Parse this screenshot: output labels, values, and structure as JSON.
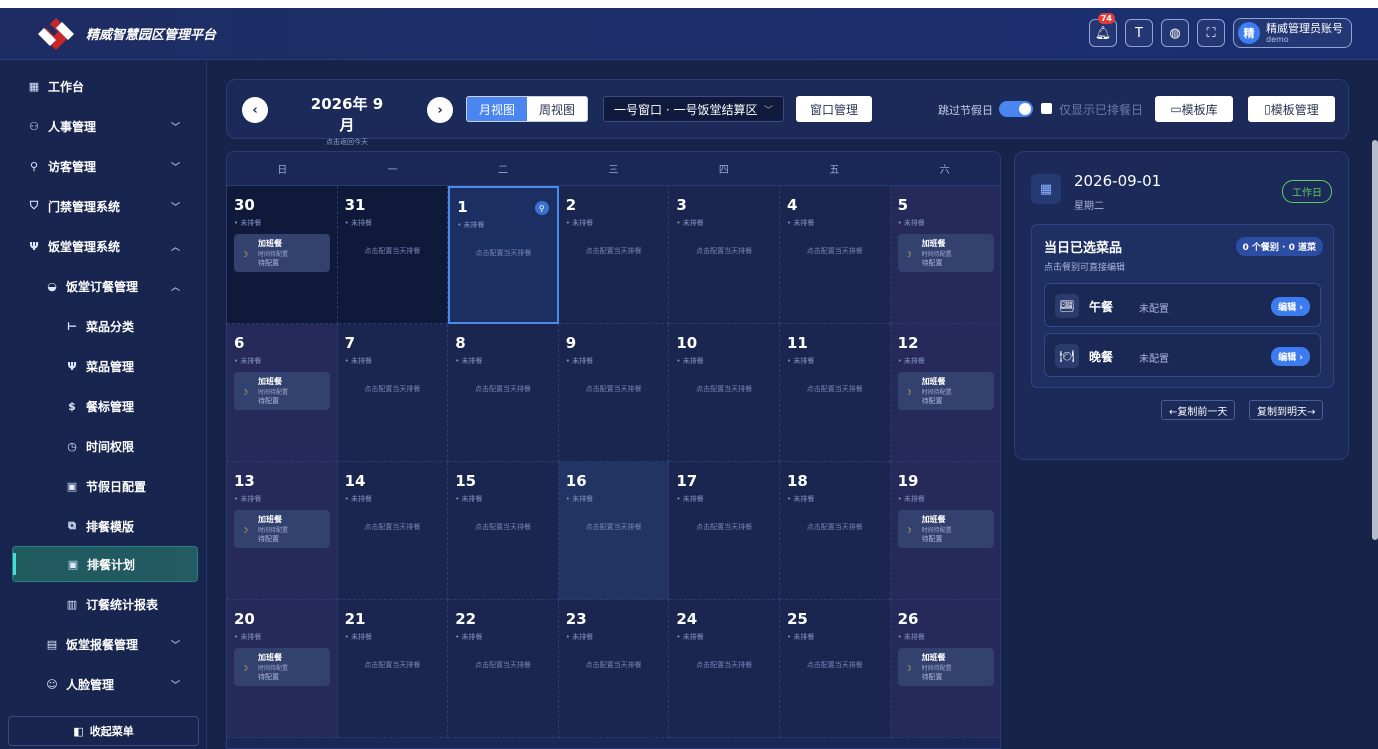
{
  "app": {
    "brand": "精威智慧园区管理平台"
  },
  "header": {
    "notification_count": "74",
    "font_label": "T",
    "user_avatar": "精",
    "user_name": "精威管理员账号",
    "user_role": "demo"
  },
  "sidebar": {
    "items": [
      {
        "label": "工作台",
        "icon": "grid-icon"
      },
      {
        "label": "人事管理",
        "icon": "users-icon"
      },
      {
        "label": "访客管理",
        "icon": "visitor-icon"
      },
      {
        "label": "门禁管理系统",
        "icon": "shield-icon"
      },
      {
        "label": "饭堂管理系统",
        "icon": "utensils-icon"
      },
      {
        "label": "饭堂订餐管理",
        "icon": "bowl-icon"
      },
      {
        "label": "菜品分类",
        "icon": "tree-icon"
      },
      {
        "label": "菜品管理",
        "icon": "utensils-icon"
      },
      {
        "label": "餐标管理",
        "icon": "coin-icon"
      },
      {
        "label": "时间权限",
        "icon": "clock-icon"
      },
      {
        "label": "节假日配置",
        "icon": "calendar-icon"
      },
      {
        "label": "排餐模版",
        "icon": "template-icon"
      },
      {
        "label": "排餐计划",
        "icon": "calendar-icon"
      },
      {
        "label": "订餐统计报表",
        "icon": "bar-chart-icon"
      },
      {
        "label": "饭堂报餐管理",
        "icon": "clipboard-icon"
      },
      {
        "label": "人脸管理",
        "icon": "face-icon"
      }
    ],
    "collapse_label": "收起菜单"
  },
  "toolbar": {
    "month": "2026年 9月",
    "back_today": "点击返回今天",
    "view_month": "月视图",
    "view_week": "周视图",
    "window_select": "一号窗口 · 一号饭堂结算区",
    "window_manage": "窗口管理",
    "skip_holiday": "跳过节假日",
    "only_show": "仅显示已排餐日",
    "template_lib": "模板库",
    "template_manage": "模板管理"
  },
  "calendar": {
    "weekdays": [
      "日",
      "一",
      "二",
      "三",
      "四",
      "五",
      "六"
    ],
    "status_text": "• 未排餐",
    "config_hint": "点击配置当天排餐",
    "ot_title": "加班餐",
    "ot_time": "时间待配置",
    "ot_status": "待配置",
    "days": [
      "30",
      "31",
      "1",
      "2",
      "3",
      "4",
      "5",
      "6",
      "7",
      "8",
      "9",
      "10",
      "11",
      "12",
      "13",
      "14",
      "15",
      "16",
      "17",
      "18",
      "19",
      "20",
      "21",
      "22",
      "23",
      "24",
      "25",
      "26"
    ]
  },
  "panel": {
    "date": "2026-09-01",
    "weekday": "星期二",
    "day_type": "工作日",
    "title": "当日已选菜品",
    "subtitle": "点击餐别可直接编辑",
    "summary": "0 个餐别 · 0 道菜",
    "meals": [
      {
        "name": "午餐",
        "status": "未配置",
        "edit": "编辑 ›"
      },
      {
        "name": "晚餐",
        "status": "未配置",
        "edit": "编辑 ›"
      }
    ],
    "copy_prev": "←复制前一天",
    "copy_next": "复制到明天→"
  },
  "colors": {
    "accent": "#4a85f0",
    "active_menu": "#1f5a5f",
    "workday": "#5ad061",
    "badge": "#e53935"
  }
}
